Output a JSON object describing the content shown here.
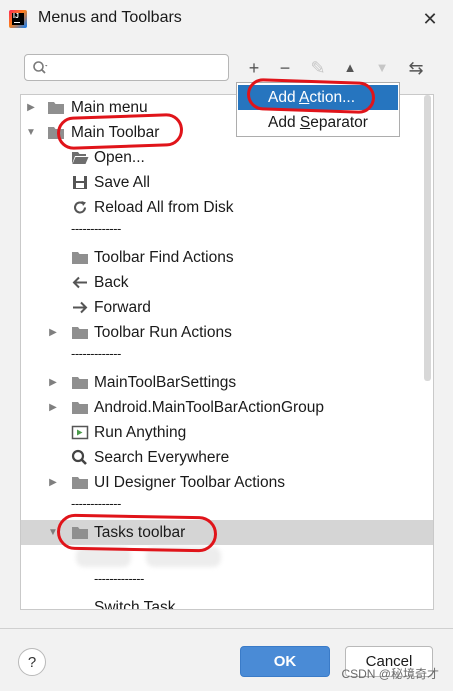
{
  "window": {
    "title": "Menus and Toolbars",
    "close_glyph": "✕"
  },
  "search": {
    "placeholder": "",
    "value": ""
  },
  "toolbar": {
    "add_glyph": "+",
    "remove_glyph": "−",
    "edit_glyph": "✎",
    "up_glyph": "▲",
    "down_glyph": "▼",
    "restore_glyph": "⇆"
  },
  "popup": {
    "add_action_pre": "Add ",
    "add_action_ul": "A",
    "add_action_post": "ction...",
    "add_separator_pre": "Add ",
    "add_separator_ul": "S",
    "add_separator_post": "eparator"
  },
  "tree": {
    "main_menu": "Main menu",
    "main_toolbar": "Main Toolbar",
    "open": "Open...",
    "save_all": "Save All",
    "reload": "Reload All from Disk",
    "sep1": "-------------",
    "find_actions": "Toolbar Find Actions",
    "back": "Back",
    "forward": "Forward",
    "run_actions": "Toolbar Run Actions",
    "sep2": "-------------",
    "settings": "MainToolBarSettings",
    "android": "Android.MainToolBarActionGroup",
    "run_anything": "Run Anything",
    "search_everywhere": "Search Everywhere",
    "ui_designer": "UI Designer Toolbar Actions",
    "sep3": "-------------",
    "tasks": "Tasks toolbar",
    "sep4": "-------------",
    "switch_task": "Switch Task"
  },
  "buttons": {
    "help": "?",
    "ok": "OK",
    "cancel": "Cancel"
  },
  "watermark": "CSDN @秘境奇才",
  "colors": {
    "selection": "#2675bf",
    "ok_button": "#4a8bd6",
    "annotation": "#e0141a"
  }
}
